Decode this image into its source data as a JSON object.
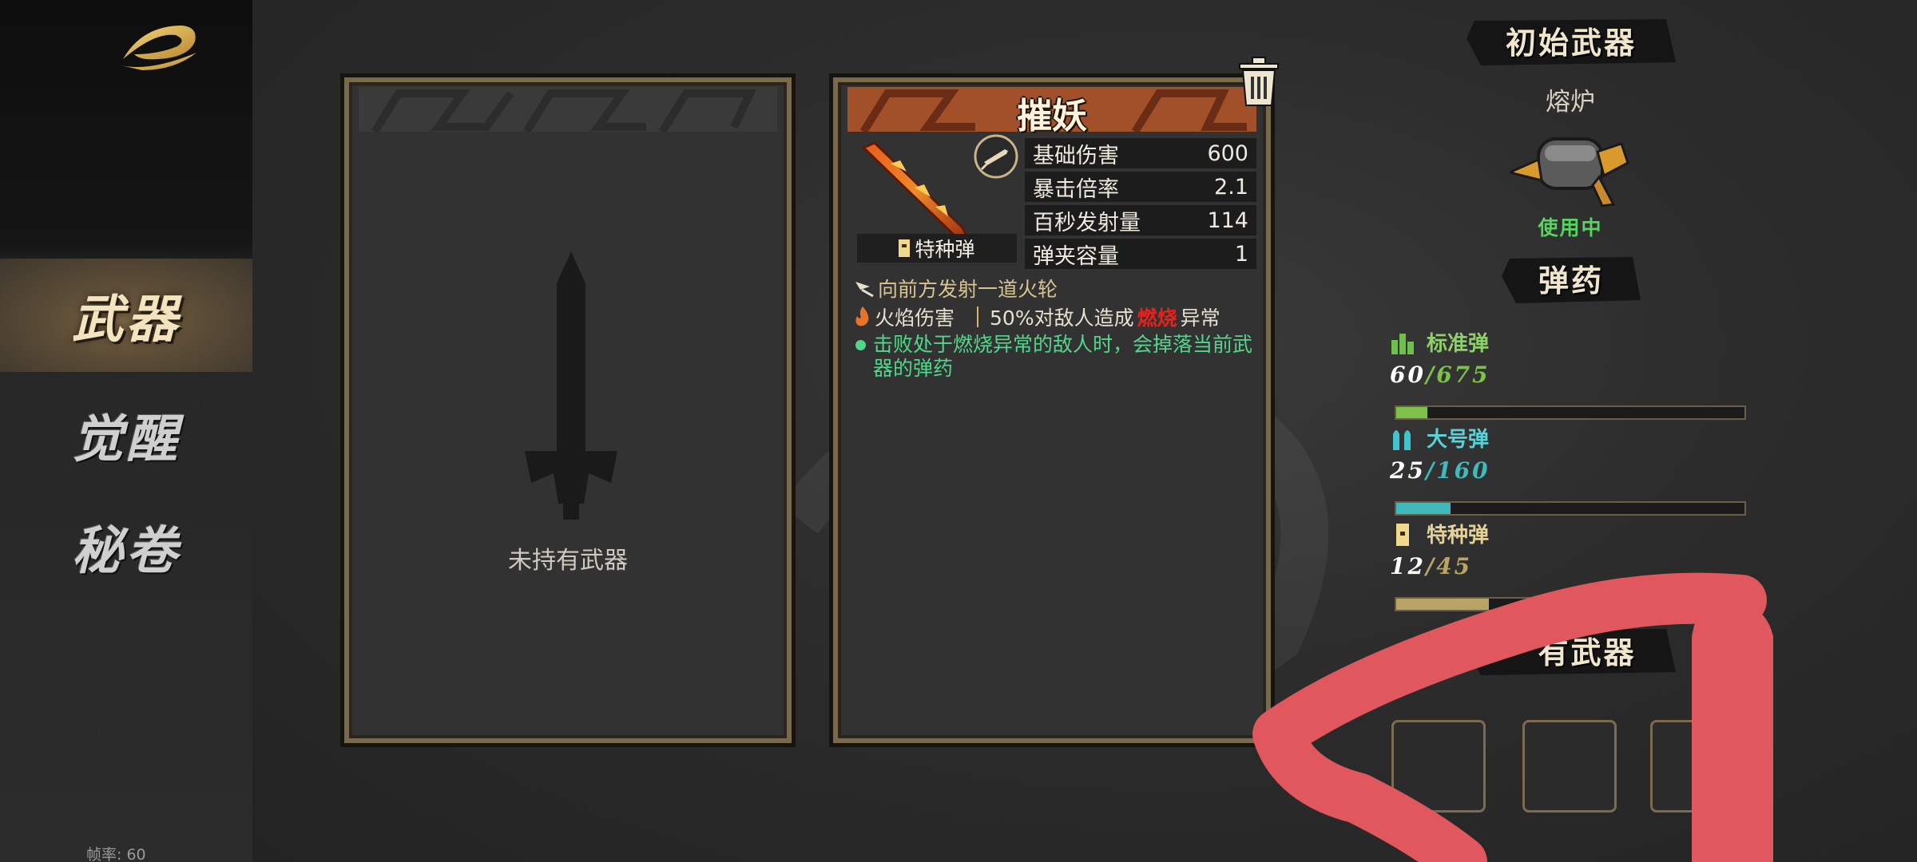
{
  "sidebar": {
    "logo_icon": "golden-swirl-logo-icon",
    "items": [
      {
        "label": "武器",
        "active": true
      },
      {
        "label": "觉醒",
        "active": false
      },
      {
        "label": "秘卷",
        "active": false
      }
    ],
    "fps": "帧率: 60"
  },
  "left_panel": {
    "empty_text": "未持有武器",
    "icon": "sword-silhouette-icon"
  },
  "right_panel": {
    "title": "摧妖",
    "ammo_type": "特种弹",
    "stats": [
      {
        "label": "基础伤害",
        "value": "600"
      },
      {
        "label": "暴击倍率",
        "value": "2.1"
      },
      {
        "label": "百秒发射量",
        "value": "114"
      },
      {
        "label": "弹夹容量",
        "value": "1"
      }
    ],
    "desc1": "向前方发射一道火轮",
    "desc2_a": "火焰伤害",
    "desc2_b": "50%对敌人造成",
    "desc2_burn": "燃烧",
    "desc2_c": "异常",
    "bonus": "击败处于燃烧异常的敌人时，会掉落当前武器的弹药",
    "trash_icon": "trash-icon"
  },
  "initial_weapon": {
    "header": "初始武器",
    "name": "熔炉",
    "status": "使用中"
  },
  "ammo": {
    "header": "弹药",
    "items": [
      {
        "name": "标准弹",
        "current": "60",
        "sep": "/",
        "max": "675",
        "fill": 0.089,
        "color": "#7cc24a"
      },
      {
        "name": "大号弹",
        "current": "25",
        "sep": "/",
        "max": "160",
        "fill": 0.156,
        "color": "#3fb9b9"
      },
      {
        "name": "特种弹",
        "current": "12",
        "sep": "/",
        "max": "45",
        "fill": 0.267,
        "color": "#b9a468"
      }
    ]
  },
  "held_weapons": {
    "header_visible": "有武器",
    "slots": 3
  },
  "colors": {
    "accent_gold": "#f3e3bf",
    "bonus_green": "#52d68a",
    "burn_red": "#e8211a",
    "scribble_red": "#e0575d"
  }
}
